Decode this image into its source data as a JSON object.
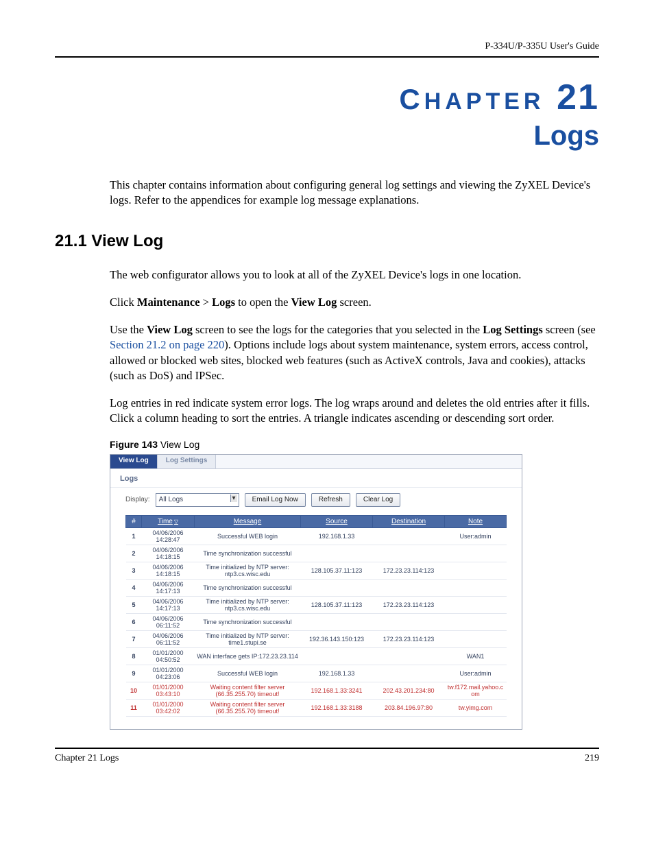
{
  "header": {
    "guide": "P-334U/P-335U User's Guide"
  },
  "chapter": {
    "small_caps": "C",
    "rest": "HAPTER",
    "num": "21",
    "subtitle": "Logs"
  },
  "intro": "This chapter contains information about configuring general log settings and viewing the ZyXEL Device's logs. Refer to the appendices for example log message explanations.",
  "section": {
    "heading": "21.1  View Log",
    "p1": "The web configurator allows you to look at all of the ZyXEL Device's logs in one location.",
    "p2_a": "Click ",
    "p2_b": "Maintenance",
    "p2_c": " > ",
    "p2_d": "Logs",
    "p2_e": " to open the ",
    "p2_f": "View Log",
    "p2_g": " screen.",
    "p3_a": "Use the ",
    "p3_b": "View Log",
    "p3_c": " screen to see the logs for the categories that you selected in the ",
    "p3_d": "Log Settings",
    "p3_e": " screen (see ",
    "p3_link": "Section 21.2 on page 220",
    "p3_f": "). Options include logs about system maintenance, system errors, access control, allowed or blocked web sites, blocked web features (such as ActiveX controls, Java and cookies), attacks (such as DoS) and IPSec.",
    "p4": "Log entries in red indicate system error logs. The log wraps around and deletes the old entries after it fills. Click a column heading to sort the entries. A triangle indicates ascending or descending sort order."
  },
  "figure": {
    "label": "Figure 143",
    "title": "   View Log"
  },
  "shot": {
    "tab_active": "View Log",
    "tab_inactive": "Log Settings",
    "panel_title": "Logs",
    "display_label": "Display:",
    "display_value": "All Logs",
    "btn_email": "Email Log Now",
    "btn_refresh": "Refresh",
    "btn_clear": "Clear Log",
    "columns": {
      "num": "#",
      "time": "Time",
      "sort_ind": "▽",
      "msg": "Message",
      "src": "Source",
      "dst": "Destination",
      "note": "Note"
    },
    "rows": [
      {
        "n": "1",
        "t": "04/06/2006 14:28:47",
        "m": "Successful WEB login",
        "s": "192.168.1.33",
        "d": "",
        "note": "User:admin",
        "err": false
      },
      {
        "n": "2",
        "t": "04/06/2006 14:18:15",
        "m": "Time synchronization successful",
        "s": "",
        "d": "",
        "note": "",
        "err": false
      },
      {
        "n": "3",
        "t": "04/06/2006 14:18:15",
        "m": "Time initialized by NTP server: ntp3.cs.wisc.edu",
        "s": "128.105.37.11:123",
        "d": "172.23.23.114:123",
        "note": "",
        "err": false
      },
      {
        "n": "4",
        "t": "04/06/2006 14:17:13",
        "m": "Time synchronization successful",
        "s": "",
        "d": "",
        "note": "",
        "err": false
      },
      {
        "n": "5",
        "t": "04/06/2006 14:17:13",
        "m": "Time initialized by NTP server: ntp3.cs.wisc.edu",
        "s": "128.105.37.11:123",
        "d": "172.23.23.114:123",
        "note": "",
        "err": false
      },
      {
        "n": "6",
        "t": "04/06/2006 06:11:52",
        "m": "Time synchronization successful",
        "s": "",
        "d": "",
        "note": "",
        "err": false
      },
      {
        "n": "7",
        "t": "04/06/2006 06:11:52",
        "m": "Time initialized by NTP server: time1.stupi.se",
        "s": "192.36.143.150:123",
        "d": "172.23.23.114:123",
        "note": "",
        "err": false
      },
      {
        "n": "8",
        "t": "01/01/2000 04:50:52",
        "m": "WAN interface gets IP:172.23.23.114",
        "s": "",
        "d": "",
        "note": "WAN1",
        "err": false
      },
      {
        "n": "9",
        "t": "01/01/2000 04:23:06",
        "m": "Successful WEB login",
        "s": "192.168.1.33",
        "d": "",
        "note": "User:admin",
        "err": false
      },
      {
        "n": "10",
        "t": "01/01/2000 03:43:10",
        "m": "Waiting content filter server (66.35.255.70) timeout!",
        "s": "192.168.1.33:3241",
        "d": "202.43.201.234:80",
        "note": "tw.f172.mail.yahoo.com",
        "err": true
      },
      {
        "n": "11",
        "t": "01/01/2000 03:42:02",
        "m": "Waiting content filter server (66.35.255.70) timeout!",
        "s": "192.168.1.33:3188",
        "d": "203.84.196.97:80",
        "note": "tw.yimg.com",
        "err": true
      }
    ]
  },
  "footer": {
    "left": "Chapter 21 Logs",
    "right": "219"
  }
}
